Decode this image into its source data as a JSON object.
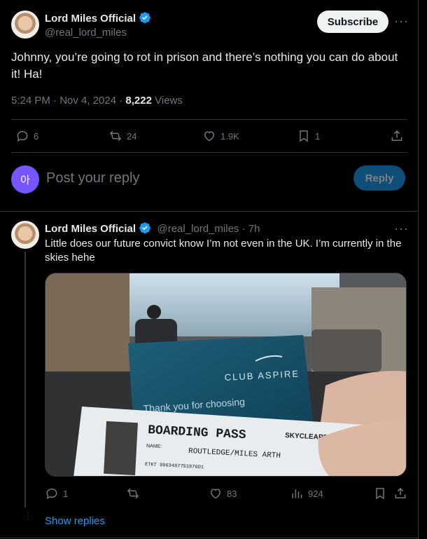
{
  "main_tweet": {
    "author_name": "Lord Miles Official",
    "author_handle": "@real_lord_miles",
    "subscribe_label": "Subscribe",
    "text": "Johnny, you’re going to rot in prison and there’s nothing you can do about it! Ha!",
    "time": "5:24 PM · Nov 4, 2024 · ",
    "views_count": "8,222",
    "views_label": " Views",
    "stats": {
      "replies": "6",
      "reposts": "24",
      "likes": "1.9K",
      "bookmarks": "1"
    }
  },
  "composer": {
    "avatar_initial": "아",
    "placeholder": "Post your reply",
    "reply_label": "Reply"
  },
  "reply_tweet": {
    "author_name": "Lord Miles Official",
    "author_handle": "@real_lord_miles",
    "age": " · 7h",
    "text": "Little does our future convict know I’m not even in the UK. I’m currently in the skies hehe",
    "image": {
      "club_text": "CLUB ASPIRE",
      "thank_text": "Thank you for choosing",
      "boarding_text": "BOARDING PASS",
      "skycleared": "SKYCLEARED",
      "name_label": "NAME:",
      "passenger": "ROUTLEDGE/MILES ARTH",
      "ticket": "ETKT 9963487751876O1"
    },
    "stats": {
      "replies": "1",
      "likes": "83",
      "views": "924"
    }
  },
  "show_replies_label": "Show replies",
  "colors": {
    "accent": "#1d9bf0",
    "verified": "#1d9bf0",
    "background": "#000000"
  }
}
